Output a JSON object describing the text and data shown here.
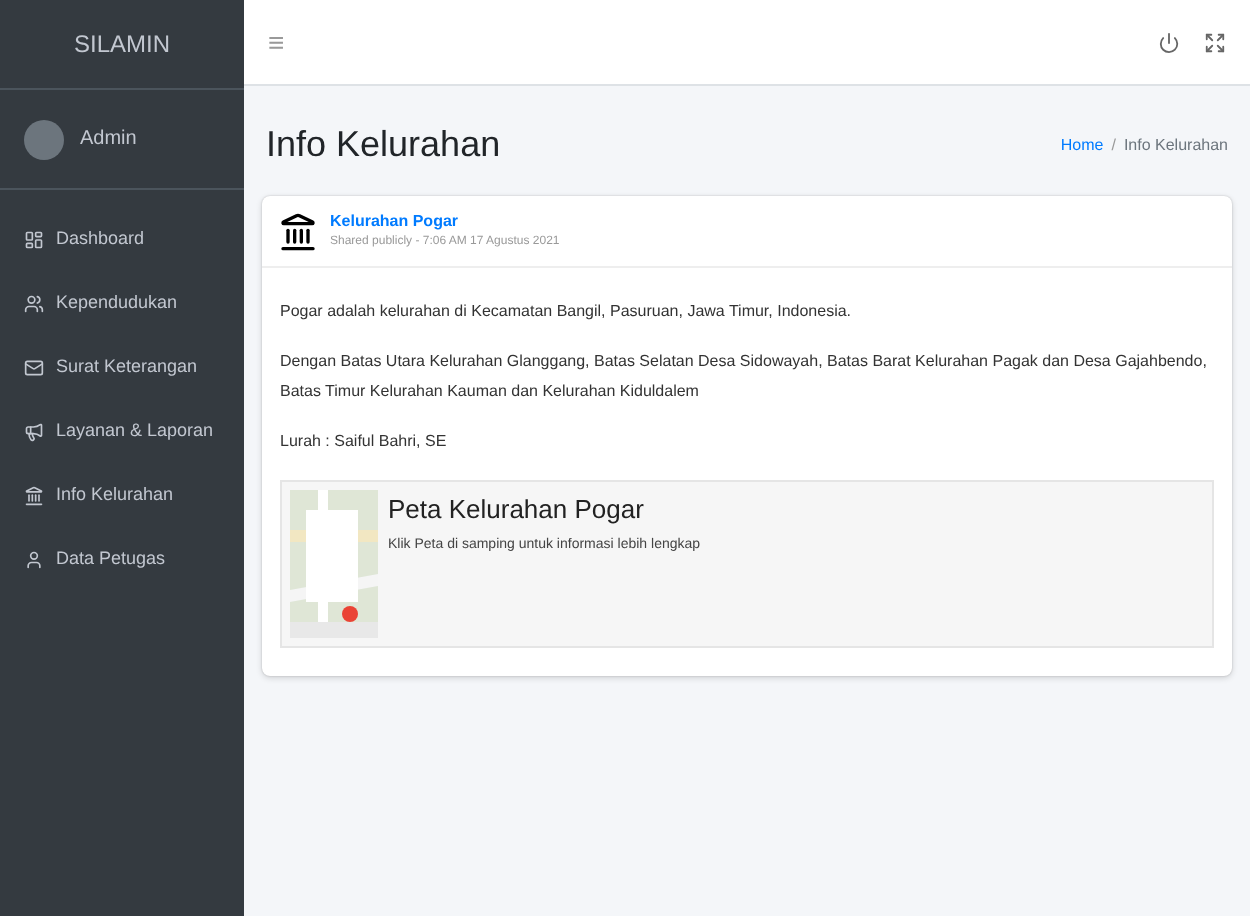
{
  "sidebar": {
    "brand": "SILAMIN",
    "user": "Admin",
    "items": [
      {
        "label": "Dashboard",
        "selected": false
      },
      {
        "label": "Kependudukan",
        "selected": false
      },
      {
        "label": "Surat Keterangan",
        "selected": false
      },
      {
        "label": "Layanan & Laporan",
        "selected": false
      },
      {
        "label": "Info Kelurahan",
        "selected": false
      },
      {
        "label": "Data Petugas",
        "selected": false
      }
    ]
  },
  "header": {
    "menu": "≡"
  },
  "page": {
    "title": "Info Kelurahan",
    "breadcrumb": [
      {
        "label": "Home",
        "kind": "link"
      },
      {
        "label": "/",
        "kind": "separator"
      },
      {
        "label": "Info Kelurahan",
        "kind": "current"
      }
    ]
  },
  "card": {
    "name": "Kelurahan Pogar",
    "meta": "Shared publicly - 7:06 AM 17 Agustus 2021",
    "paragraphs": [
      "Pogar adalah kelurahan di Kecamatan Bangil, Pasuruan, Jawa Timur, Indonesia.",
      "Dengan Batas Utara Kelurahan Glanggang, Batas Selatan Desa Sidowayah, Batas Barat Kelurahan Pagak dan Desa Gajahbendo, Batas Timur Kelurahan Kauman dan Kelurahan Kiduldalem",
      "Lurah : Saiful Bahri, SE"
    ],
    "map": {
      "title": "Peta Kelurahan Pogar",
      "description": "Klik Peta di samping untuk informasi lebih lengkap"
    }
  }
}
